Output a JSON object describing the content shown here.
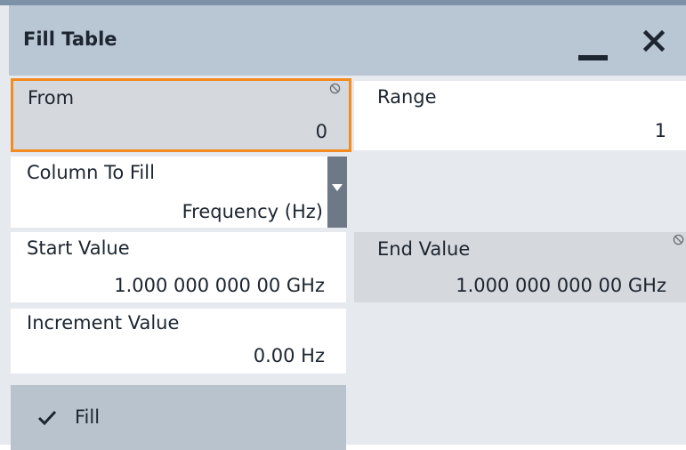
{
  "window": {
    "title": "Fill Table"
  },
  "controls": {
    "minimize_icon": "minimize-icon",
    "close_icon": "close-icon"
  },
  "fields": {
    "from": {
      "label": "From",
      "value": "0",
      "icon": "blocked-icon"
    },
    "range": {
      "label": "Range",
      "value": "1"
    },
    "column_to_fill": {
      "label": "Column To Fill",
      "value": "Frequency (Hz)",
      "icon": "dropdown-arrow-icon"
    },
    "start_value": {
      "label": "Start Value",
      "value": "1.000 000 000 00 GHz"
    },
    "end_value": {
      "label": "End Value",
      "value": "1.000 000 000 00 GHz",
      "icon": "blocked-icon"
    },
    "increment_value": {
      "label": "Increment Value",
      "value": "0.00 Hz"
    }
  },
  "actions": {
    "fill_label": "Fill",
    "fill_icon": "checkmark-icon"
  },
  "colors": {
    "titlebar": "#b9c6d4",
    "focus_border": "#f38b1f",
    "readonly_bg": "#d5d8dd",
    "button_bg": "#b9c3cd"
  }
}
